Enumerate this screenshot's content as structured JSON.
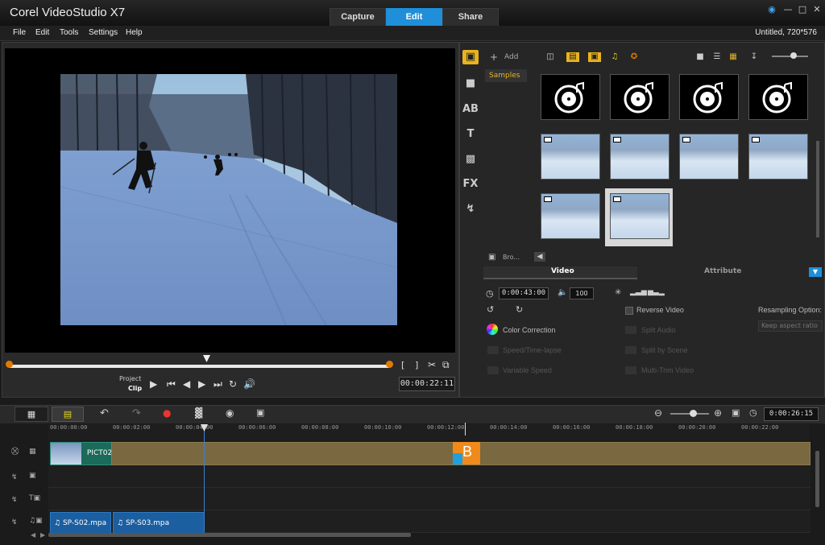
{
  "app": {
    "title": "Corel VideoStudio X7",
    "project_info": "Untitled, 720*576"
  },
  "modes": [
    "Capture",
    "Edit",
    "Share"
  ],
  "menu": [
    "File",
    "Edit",
    "Tools",
    "Settings",
    "Help"
  ],
  "preview": {
    "project_label": "Project",
    "clip_label": "Clip",
    "timecode": "00:00:22:11",
    "playhead_fraction": 0.52
  },
  "library": {
    "add_label": "Add",
    "folder_label": "Samples",
    "browse_label": "Bro...",
    "tabs": [
      "Video",
      "Attribute"
    ],
    "duration": "0:00:43:00",
    "volume": "100",
    "reverse_video": "Reverse Video",
    "resampling_label": "Resampling Option:",
    "resampling_value": "Keep aspect ratio",
    "color_correction": "Color Correction",
    "speed_time_lapse": "Speed/Time-lapse",
    "variable_speed": "Variable Speed",
    "split_audio": "Split Audio",
    "split_by_scene": "Split by Scene",
    "multi_trim_video": "Multi-Trim Video"
  },
  "timeline": {
    "timecode": "0:00:26:15",
    "ruler": [
      "00:00:00:00",
      "00:00:02:00",
      "00:00:04:00",
      "00:00:06:00",
      "00:00:08:00",
      "00:00:10:00",
      "00:00:12:00",
      "00:00:14:00",
      "00:00:16:00",
      "00:00:18:00",
      "00:00:20:00",
      "00:00:22:00"
    ],
    "video_clip": "PICT02",
    "transition_label": "B",
    "audio_clips": [
      "SP-S02.mpa",
      "SP-S03.mpa"
    ]
  },
  "colors": {
    "accent": "#1e8fd8",
    "clip_brown": "#7a6840",
    "transition": "#f08a1a",
    "audio_clip": "#1c5fa0"
  }
}
